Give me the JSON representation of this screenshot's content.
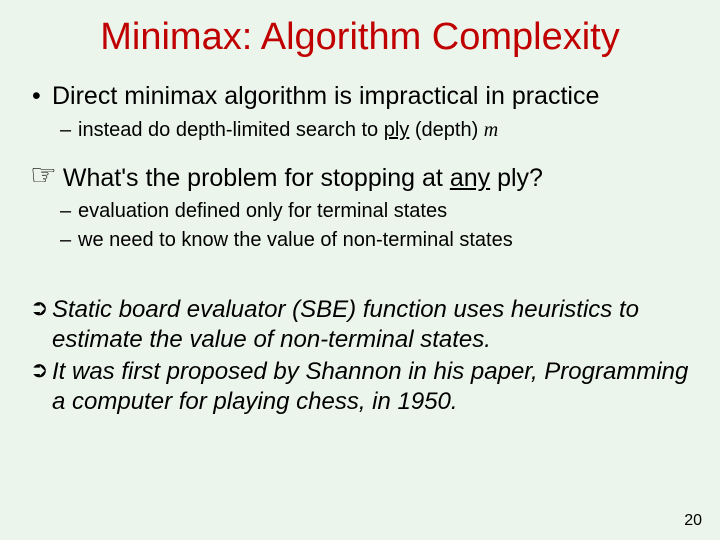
{
  "title": "Minimax: Algorithm Complexity",
  "b1": "Direct minimax algorithm is impractical in practice",
  "s1_pre": "instead do depth-limited search to ",
  "s1_ply": "ply",
  "s1_mid": " (depth) ",
  "s1_m": "m",
  "q_pre": "What's the problem for stopping at ",
  "q_any": "any",
  "q_post": " ply?",
  "s2": "evaluation defined only for terminal states",
  "s3": "we need to know the value of non-terminal states",
  "a1_sbe": "Static board evaluator (SBE)",
  "a1_rest": " function uses heuristics to estimate the value of non-terminal states.",
  "a2_pre": "It was first proposed by Shannon in his paper, ",
  "a2_title": "Programming a computer for playing chess",
  "a2_post": ", in 1950.",
  "slidenum": "20",
  "icons": {
    "hand": "☞",
    "arrow": "➲"
  }
}
